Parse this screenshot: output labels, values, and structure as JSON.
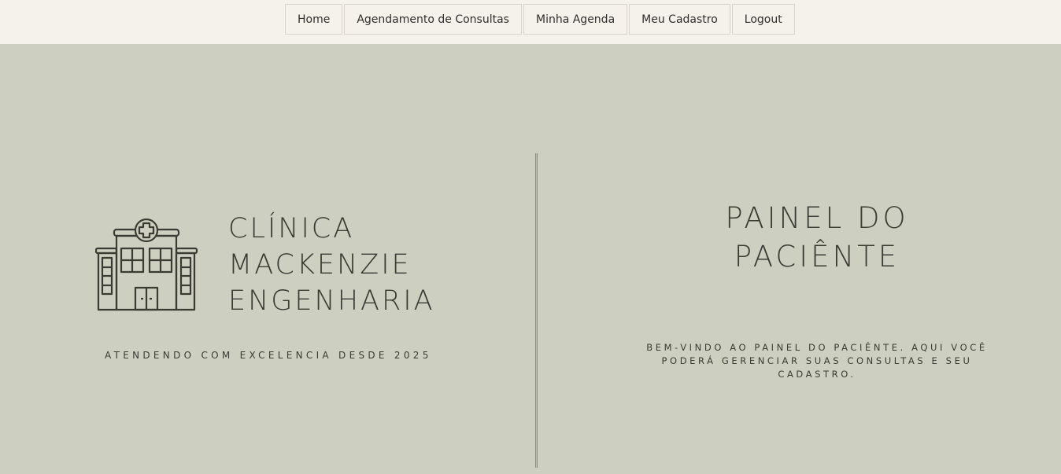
{
  "nav": {
    "items": [
      {
        "label": "Home"
      },
      {
        "label": "Agendamento de Consultas"
      },
      {
        "label": "Minha Agenda"
      },
      {
        "label": "Meu Cadastro"
      },
      {
        "label": "Logout"
      }
    ]
  },
  "brand": {
    "line1": "CLÍNICA",
    "line2": "MACKENZIE",
    "line3": "ENGENHARIA",
    "tagline": "ATENDENDO COM EXCELENCIA DESDE 2025",
    "icon": "hospital-building-icon"
  },
  "panel": {
    "title_line1": "PAINEL DO",
    "title_line2": "PACIÊNTE",
    "description": "BEM-VINDO AO PAINEL DO PACIÊNTE. AQUI VOCÊ PODERÁ GERENCIAR SUAS CONSULTAS E SEU CADASTRO."
  },
  "colors": {
    "background": "#cdcfc1",
    "topbar": "#f5f1eb",
    "text": "#3b3b33"
  }
}
